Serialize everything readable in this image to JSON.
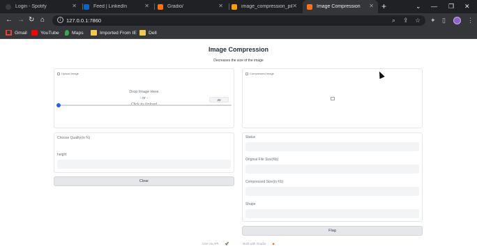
{
  "browser": {
    "tabs": [
      {
        "title": "Login - Spotify",
        "active": false,
        "fav_color": "#191414"
      },
      {
        "title": "Feed | LinkedIn",
        "active": false,
        "fav_color": "#0a66c2"
      },
      {
        "title": "Gradio/",
        "active": false,
        "fav_color": "#f97316"
      },
      {
        "title": "image_compression_pil",
        "active": false,
        "fav_color": "#f59e0b"
      },
      {
        "title": "Image Compression",
        "active": true,
        "fav_color": "#f97316"
      }
    ],
    "url": "127.0.0.1:7860",
    "bookmarks": [
      {
        "label": "Gmail",
        "icon": "gmail-icon",
        "color": "#ea4335"
      },
      {
        "label": "YouTube",
        "icon": "youtube-icon",
        "color": "#ff0000"
      },
      {
        "label": "Maps",
        "icon": "maps-icon",
        "color": "#34a853"
      },
      {
        "label": "Imported From IE",
        "icon": "folder-icon",
        "color": "#f2c94c"
      },
      {
        "label": "Dell",
        "icon": "folder-icon",
        "color": "#f2c94c"
      }
    ]
  },
  "app": {
    "title": "Image Compression",
    "subtitle": "Decreases the size of the image",
    "upload": {
      "label": "Upload Image",
      "drop_text": "Drop Image Here",
      "or_text": "- or -",
      "click_text": "Click to Upload"
    },
    "quality": {
      "label": "Choose Quality(in %)",
      "value": "20",
      "fraction": 0.2
    },
    "height_label": "height",
    "clear_label": "Clear",
    "output": {
      "label": "Compressed Image"
    },
    "status_label": "Status",
    "original_size_label": "Original File Size(Kb)",
    "compressed_size_label": "Compressed Size(in Kb)",
    "shape_label": "Shape",
    "flag_label": "Flag",
    "footer": {
      "api": "Use via API",
      "built": "Built with Gradio"
    }
  },
  "colors": {
    "accent": "#2563eb",
    "chrome": "#202124"
  }
}
